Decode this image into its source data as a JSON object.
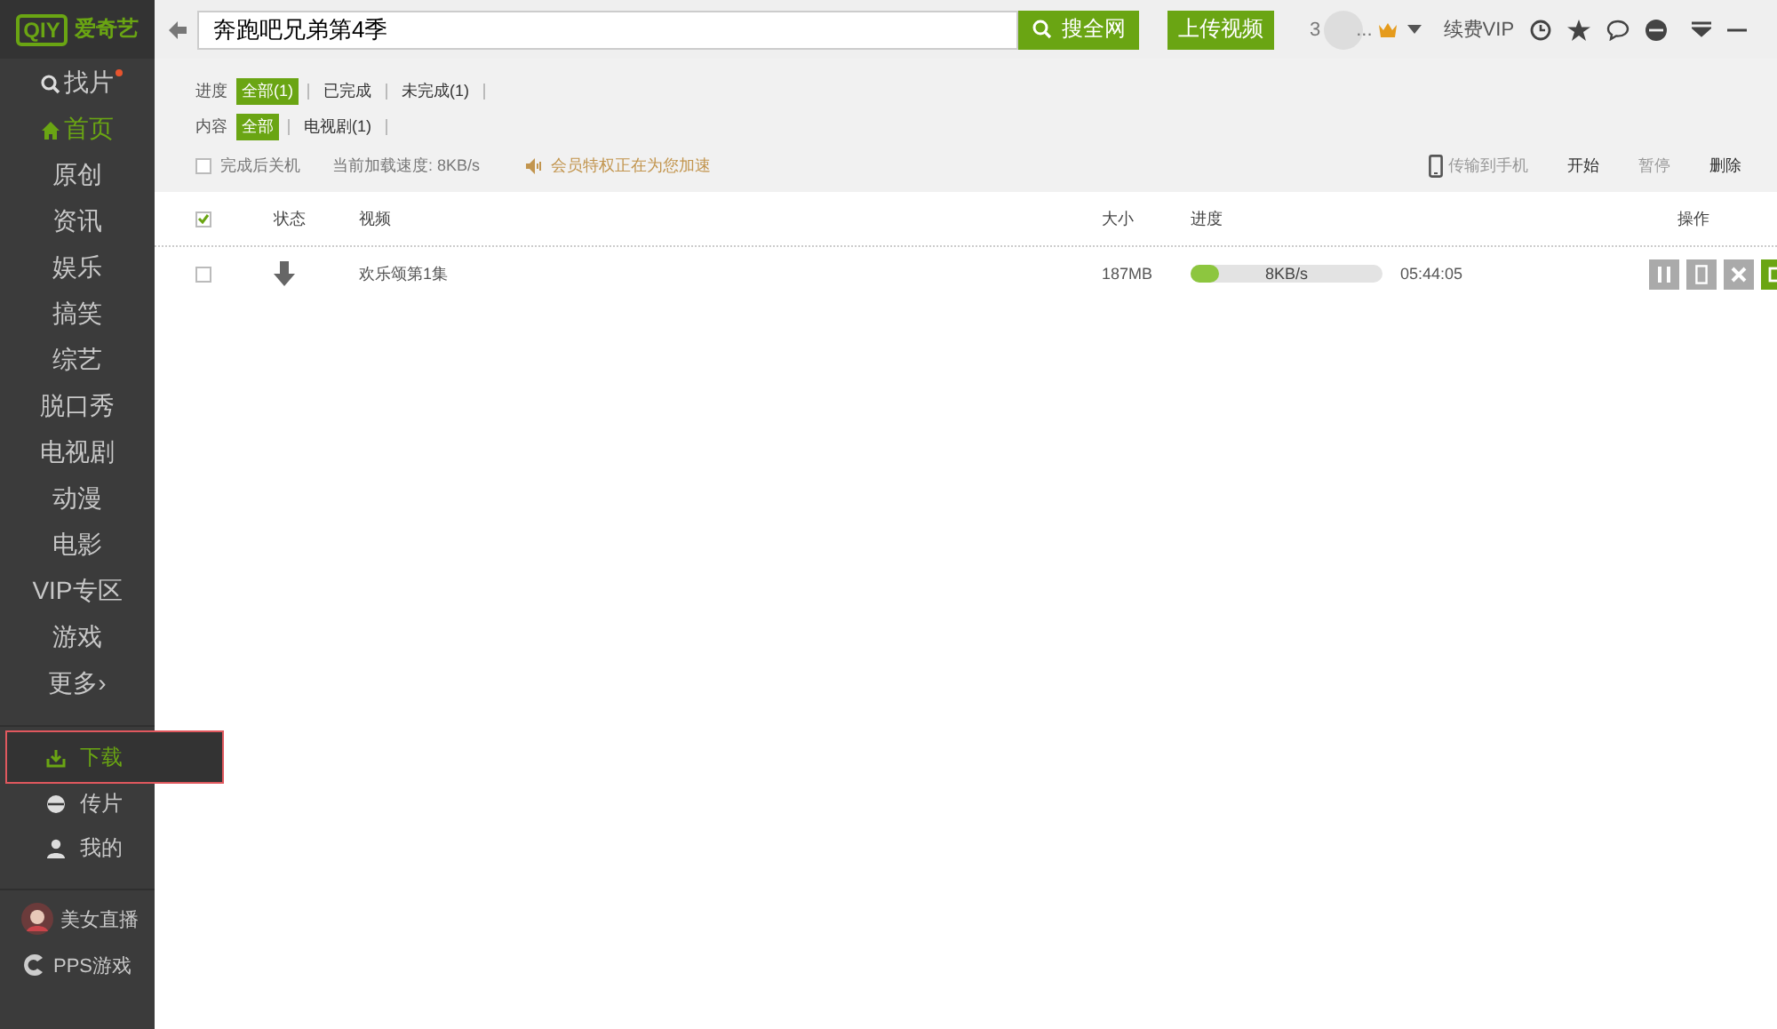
{
  "sidebar": {
    "logo_mark": "QIY",
    "logo_text": "爱奇艺",
    "nav": [
      {
        "label": "找片",
        "kind": "search",
        "dot": true,
        "selected": false
      },
      {
        "label": "首页",
        "kind": "home",
        "dot": false,
        "selected": true
      },
      {
        "label": "原创",
        "kind": "plain",
        "dot": false,
        "selected": false
      },
      {
        "label": "资讯",
        "kind": "plain",
        "dot": false,
        "selected": false
      },
      {
        "label": "娱乐",
        "kind": "plain",
        "dot": false,
        "selected": false
      },
      {
        "label": "搞笑",
        "kind": "plain",
        "dot": false,
        "selected": false
      },
      {
        "label": "综艺",
        "kind": "plain",
        "dot": false,
        "selected": false
      },
      {
        "label": "脱口秀",
        "kind": "plain",
        "dot": false,
        "selected": false
      },
      {
        "label": "电视剧",
        "kind": "plain",
        "dot": false,
        "selected": false
      },
      {
        "label": "动漫",
        "kind": "plain",
        "dot": false,
        "selected": false
      },
      {
        "label": "电影",
        "kind": "plain",
        "dot": false,
        "selected": false
      },
      {
        "label": "VIP专区",
        "kind": "plain",
        "dot": false,
        "selected": false
      },
      {
        "label": "游戏",
        "kind": "plain",
        "dot": false,
        "selected": false
      },
      {
        "label": "更多›",
        "kind": "plain",
        "dot": false,
        "selected": false
      }
    ],
    "tools": [
      {
        "label": "下载",
        "kind": "download",
        "selected": true,
        "highlighted": true
      },
      {
        "label": "传片",
        "kind": "upload",
        "selected": false,
        "highlighted": false
      },
      {
        "label": "我的",
        "kind": "user",
        "selected": false,
        "highlighted": false
      }
    ],
    "extras": [
      {
        "label": "美女直播",
        "kind": "live"
      },
      {
        "label": "PPS游戏",
        "kind": "game"
      }
    ]
  },
  "topbar": {
    "search_value": "奔跑吧兄弟第4季",
    "search_button": "搜全网",
    "upload_button": "上传视频",
    "user_name": "3",
    "user_more": "...",
    "vip_link": "续费VIP"
  },
  "filters": [
    {
      "label": "进度",
      "options": [
        {
          "label": "全部(1)",
          "selected": true
        },
        {
          "label": "已完成",
          "selected": false
        },
        {
          "label": "未完成(1)",
          "selected": false
        }
      ]
    },
    {
      "label": "内容",
      "options": [
        {
          "label": "全部",
          "selected": true
        },
        {
          "label": "电视剧(1)",
          "selected": false
        }
      ]
    }
  ],
  "options": {
    "shutdown": {
      "label": "完成后关机",
      "checked": false
    },
    "speed": "当前加载速度: 8KB/s",
    "notice": "会员特权正在为您加速"
  },
  "actions": [
    {
      "label": "传输到手机",
      "kind": "phone",
      "disabled": true
    },
    {
      "label": "开始",
      "kind": "plain",
      "disabled": false
    },
    {
      "label": "暂停",
      "kind": "plain",
      "disabled": true
    },
    {
      "label": "删除",
      "kind": "plain",
      "disabled": false
    }
  ],
  "table": {
    "all_checked": true,
    "columns": [
      "状态",
      "视频",
      "大小",
      "进度",
      "操作"
    ],
    "rows": [
      {
        "checked": false,
        "name": "欢乐颂第1集",
        "size": "187MB",
        "level": 0.15,
        "speed": "8KB/s",
        "time": "05:44:05"
      }
    ]
  }
}
